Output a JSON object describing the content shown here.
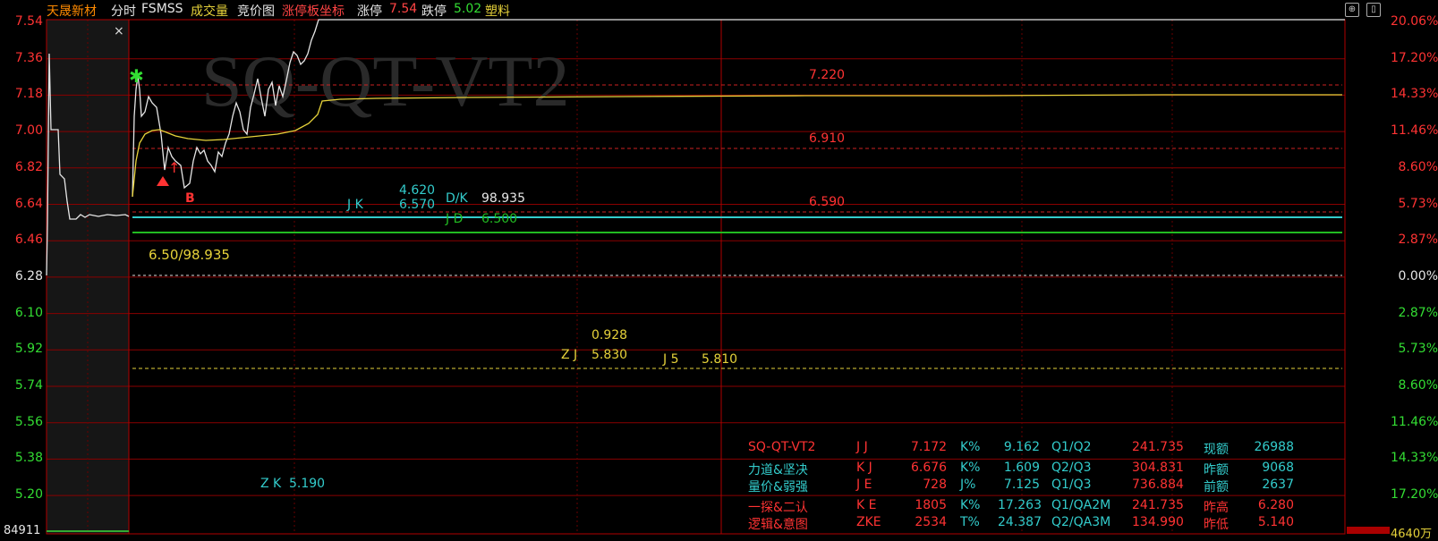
{
  "header": {
    "stock_name": "天晟新材",
    "mode": "分时",
    "indicator": "FSMSS",
    "volume": "成交量",
    "auction": "竞价图",
    "limit_axis": "涨停板坐标",
    "limit_up_label": "涨停",
    "limit_up_value": "7.54",
    "limit_down_label": "跌停",
    "limit_down_value": "5.02",
    "sector": "塑料"
  },
  "axis": {
    "left_prices": [
      "7.54",
      "7.36",
      "7.18",
      "7.00",
      "6.82",
      "6.64",
      "6.46",
      "6.28",
      "6.10",
      "5.92",
      "5.74",
      "5.56",
      "5.38",
      "5.20"
    ],
    "right_percents": [
      "20.06%",
      "17.20%",
      "14.33%",
      "11.46%",
      "8.60%",
      "5.73%",
      "2.87%",
      "0.00%",
      "2.87%",
      "5.73%",
      "8.60%",
      "11.46%",
      "14.33%",
      "17.20%"
    ],
    "bottom_left": "84911",
    "bottom_right": "4640万"
  },
  "colors": {
    "grid_red": "#b00000",
    "up_red": "#ff3333",
    "down_green": "#33dd33",
    "yellow": "#e6d23a",
    "cyan": "#33cccc",
    "white": "#e6e6e6"
  },
  "chart_labels": {
    "watermark": "SQ-QT-VT2",
    "level_7220": "7.220",
    "level_6910": "6.910",
    "level_6590": "6.590",
    "jk_label": "J K",
    "jk_top": "4.620",
    "jk_bottom": "6.570",
    "dk_label": "D/K",
    "dk_value": "98.935",
    "jd_label": "J D",
    "jd_value": "6.500",
    "ratio": "6.50/98.935",
    "zj_top": "0.928",
    "zj_label": "Z J",
    "zj_value": "5.830",
    "j5_label": "J 5",
    "j5_value": "5.810",
    "zk_label": "Z K",
    "zk_value": "5.190",
    "b_marker": "B",
    "close_x": "×"
  },
  "table": {
    "rows": [
      {
        "a": "SQ-QT-VT2",
        "b": "J J",
        "c": "7.172",
        "d": "K%",
        "e": "9.162",
        "f": "Q1/Q2",
        "g": "241.735",
        "h": "现额",
        "i": "26988"
      },
      {
        "a": "力道&坚决",
        "b": "K J",
        "c": "6.676",
        "d": "K%",
        "e": "1.609",
        "f": "Q2/Q3",
        "g": "304.831",
        "h": "昨额",
        "i": "9068"
      },
      {
        "a": "量价&弱强",
        "b": "J E",
        "c": "728",
        "d": "J%",
        "e": "7.125",
        "f": "Q1/Q3",
        "g": "736.884",
        "h": "前额",
        "i": "2637"
      },
      {
        "a": "一探&二认",
        "b": "K E",
        "c": "1805",
        "d": "K%",
        "e": "17.263",
        "f": "Q1/QA2M",
        "g": "241.735",
        "h": "昨高",
        "i": "6.280"
      },
      {
        "a": "逻辑&意图",
        "b": "ZKE",
        "c": "2534",
        "d": "T%",
        "e": "24.387",
        "f": "Q2/QA3M",
        "g": "134.990",
        "h": "昨低",
        "i": "5.140"
      }
    ]
  }
}
